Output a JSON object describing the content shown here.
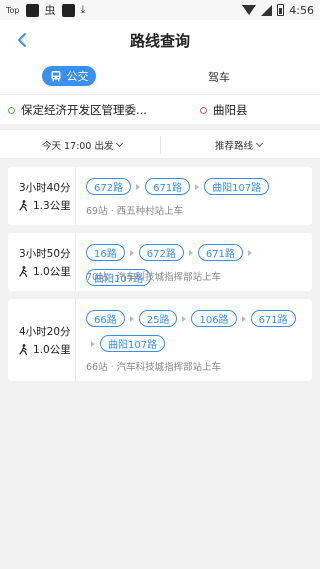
{
  "status_bar": {
    "left_badge": "Top",
    "left_glyph": "虫",
    "time": "4:56"
  },
  "header": {
    "title": "路线查询",
    "back_icon": "chevron-left-icon"
  },
  "tabs": [
    {
      "label": "公交",
      "icon": "bus-icon",
      "active": true
    },
    {
      "label": "驾车",
      "active": false
    }
  ],
  "origin": "保定经济开发区管理委...",
  "destination": "曲阳县",
  "filters": {
    "time": "今天 17:00 出发",
    "sort": "推荐路线"
  },
  "routes": [
    {
      "duration": "3小时40分",
      "walk": "1.3公里",
      "lines": [
        "672路",
        "671路",
        "曲阳107路"
      ],
      "info": "69站 · 西五种村站上车"
    },
    {
      "duration": "3小时50分",
      "walk": "1.0公里",
      "lines": [
        "16路",
        "672路",
        "671路",
        "曲阳107路"
      ],
      "info": "70站 · 汽车科技城指挥部站上车"
    },
    {
      "duration": "4小时20分",
      "walk": "1.0公里",
      "lines": [
        "66路",
        "25路",
        "106路",
        "671路",
        "曲阳107路"
      ],
      "info": "66站 · 汽车科技城指挥部站上车"
    }
  ],
  "colors": {
    "accent": "#3a8ff2",
    "origin_dot": "#49b649",
    "destination_dot": "#e9546b"
  }
}
